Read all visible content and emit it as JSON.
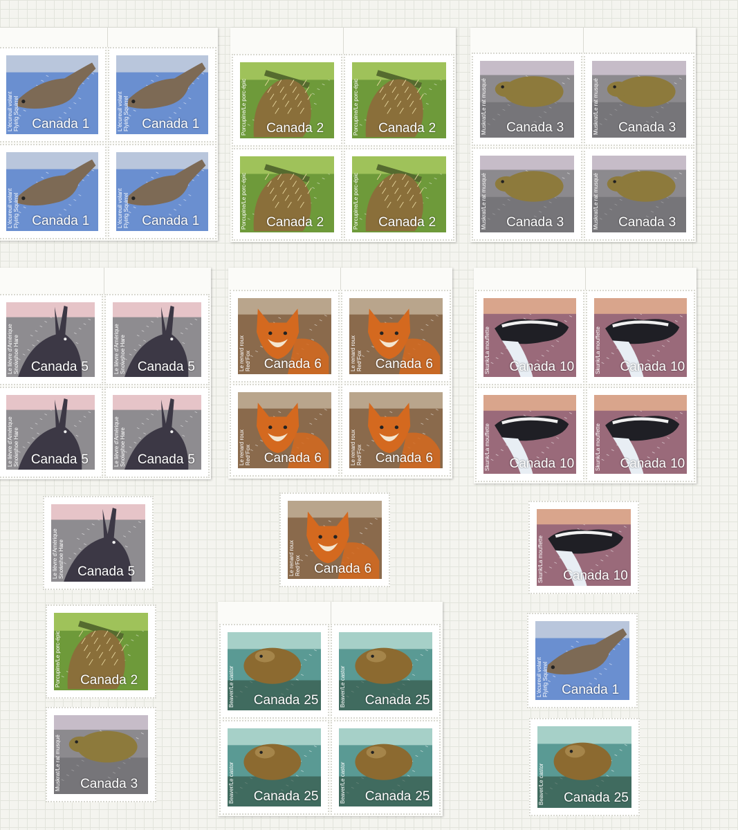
{
  "species": {
    "squirrel": {
      "caption_fr": "L'écureuil volant",
      "caption_en": "Flying Squirrel",
      "denomination": "1",
      "colors": {
        "bg": "#6a8fd0",
        "band": "#b9c6dc",
        "animal": "#7d6a55"
      }
    },
    "porcupine": {
      "caption_fr": "Porcupine/Le porc-épic",
      "caption_en": "",
      "denomination": "2",
      "colors": {
        "bg": "#6e9a3a",
        "band": "#9fc25a",
        "animal": "#8a6f3a"
      }
    },
    "muskrat": {
      "caption_fr": "Muskrat/Le rat musqué",
      "caption_en": "",
      "denomination": "3",
      "colors": {
        "bg": "#8c8a8e",
        "band": "#c6bcc8",
        "animal": "#8d7a3c"
      }
    },
    "hare": {
      "caption_fr": "Le lièvre d'Amérique",
      "caption_en": "Snowshoe Hare",
      "denomination": "5",
      "colors": {
        "bg": "#8e8c90",
        "band": "#e6c4c8",
        "animal": "#3c3845"
      }
    },
    "fox": {
      "caption_fr": "Le renard roux",
      "caption_en": "Red Fox",
      "denomination": "6",
      "colors": {
        "bg": "#8a6a4c",
        "band": "#b9a58c",
        "animal": "#d4691f"
      }
    },
    "skunk": {
      "caption_fr": "Skunk/La mouffette",
      "caption_en": "",
      "denomination": "10",
      "colors": {
        "bg": "#9a6a7a",
        "band": "#d9a58c",
        "animal": "#1f1f25"
      }
    },
    "beaver": {
      "caption_fr": "Beaver/Le castor",
      "caption_en": "",
      "denomination": "25",
      "colors": {
        "bg": "#5a9a94",
        "band": "#a6d0c8",
        "animal": "#8c6a30"
      }
    }
  },
  "country_name": "Canada"
}
